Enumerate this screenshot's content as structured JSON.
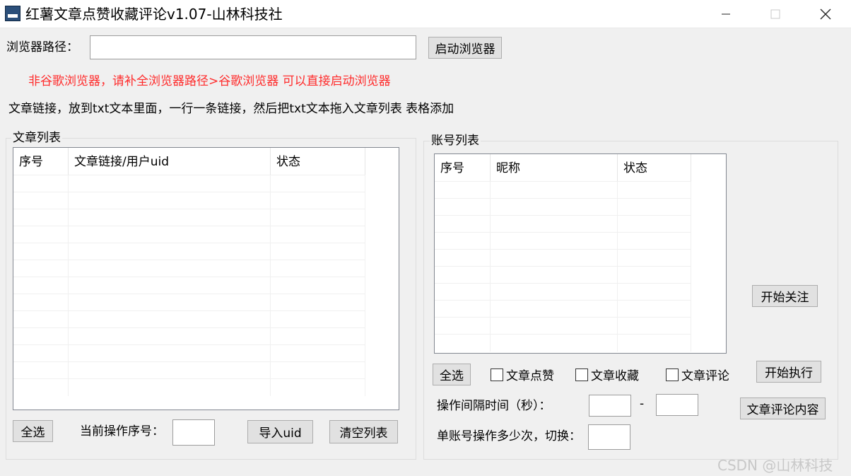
{
  "window": {
    "title": "红薯文章点赞收藏评论v1.07-山林科技社"
  },
  "browser": {
    "path_label": "浏览器路径：",
    "path_value": "",
    "launch_button": "启动浏览器",
    "hint": "非谷歌浏览器，请补全浏览器路径>谷歌浏览器 可以直接启动浏览器"
  },
  "instructions": "文章链接，放到txt文本里面，一行一条链接，然后把txt文本拖入文章列表 表格添加",
  "article_panel": {
    "group_title": "文章列表",
    "columns": [
      "序号",
      "文章链接/用户uid",
      "状态"
    ],
    "select_all_button": "全选",
    "current_index_label": "当前操作序号：",
    "current_index_value": "",
    "import_uid_button": "导入uid",
    "clear_list_button": "清空列表"
  },
  "account_panel": {
    "group_title": "账号列表",
    "columns": [
      "序号",
      "昵称",
      "状态"
    ],
    "start_follow_button": "开始关注",
    "select_all_button": "全选",
    "checkboxes": [
      {
        "label": "文章点赞",
        "checked": false
      },
      {
        "label": "文章收藏",
        "checked": false
      },
      {
        "label": "文章评论",
        "checked": false
      }
    ],
    "start_execute_button": "开始执行",
    "interval_label": "操作间隔时间（秒）：",
    "interval_min": "",
    "interval_dash": "-",
    "interval_max": "",
    "comment_content_button": "文章评论内容",
    "switch_label": "单账号操作多少次，切换：",
    "switch_value": ""
  },
  "watermark": "CSDN @山林科技"
}
